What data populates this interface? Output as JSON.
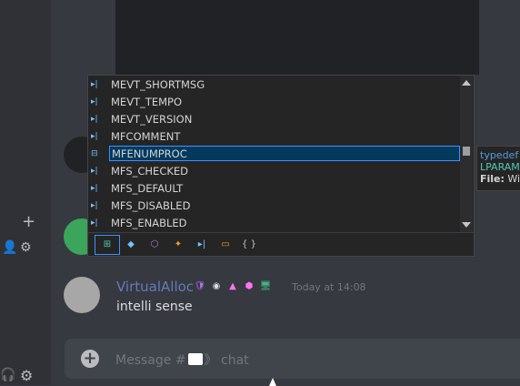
{
  "autocomplete": {
    "items": [
      {
        "label": "MEVT_SHORTMSG",
        "icon": "constant-icon"
      },
      {
        "label": "MEVT_TEMPO",
        "icon": "constant-icon"
      },
      {
        "label": "MEVT_VERSION",
        "icon": "constant-icon"
      },
      {
        "label": "MFCOMMENT",
        "icon": "constant-icon"
      },
      {
        "label": "MFENUMPROC",
        "icon": "typedef-icon",
        "selected": true
      },
      {
        "label": "MFS_CHECKED",
        "icon": "constant-icon"
      },
      {
        "label": "MFS_DEFAULT",
        "icon": "constant-icon"
      },
      {
        "label": "MFS_DISABLED",
        "icon": "constant-icon"
      },
      {
        "label": "MFS_ENABLED",
        "icon": "constant-icon"
      }
    ],
    "filters": [
      "expand-icon",
      "class-icon",
      "struct-icon",
      "enum-icon",
      "constant-icon",
      "field-icon",
      "namespace-icon"
    ]
  },
  "tooltip": {
    "line1": "typedef in",
    "line2": "LPARAM",
    "line3_label": "File:",
    "line3_value": "Win"
  },
  "message": {
    "username": "VirtualAlloc",
    "timestamp": "Today at 14:08",
    "text": "intelli sense"
  },
  "composer": {
    "placeholder_prefix": "Message #",
    "placeholder_suffix": "》 chat"
  },
  "colors": {
    "username": "#7289da",
    "badge_pink": "#ff73fa",
    "badge_green": "#43b581"
  }
}
